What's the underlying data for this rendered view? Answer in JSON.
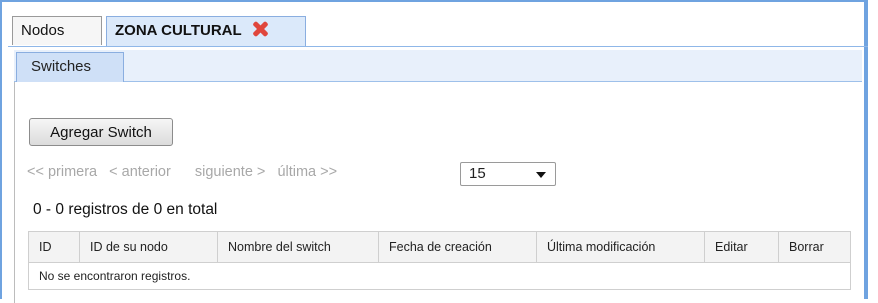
{
  "tabs": [
    {
      "label": "Nodos"
    },
    {
      "label": "ZONA CULTURAL",
      "closable": true,
      "active": true
    }
  ],
  "subtabs": [
    {
      "label": "Switches",
      "active": true
    }
  ],
  "toolbar": {
    "add_button_label": "Agregar Switch"
  },
  "pager": {
    "first": "<< primera",
    "prev": "< anterior",
    "next": "siguiente >",
    "last": "última >>",
    "page_size": "15"
  },
  "records_summary": "0 - 0 registros de 0 en total",
  "table": {
    "columns": [
      "ID",
      "ID de su nodo",
      "Nombre del switch",
      "Fecha de creación",
      "Última modificación",
      "Editar",
      "Borrar"
    ],
    "empty_message": "No se encontraron registros."
  },
  "colors": {
    "frame_border": "#6fa3e0",
    "active_tab": "#dbe9fa",
    "close_icon": "#e0463c",
    "pager_disabled": "#a8a8a8"
  },
  "icons": {
    "tab_close": "close-x-icon",
    "dropdown": "chevron-down-icon"
  }
}
